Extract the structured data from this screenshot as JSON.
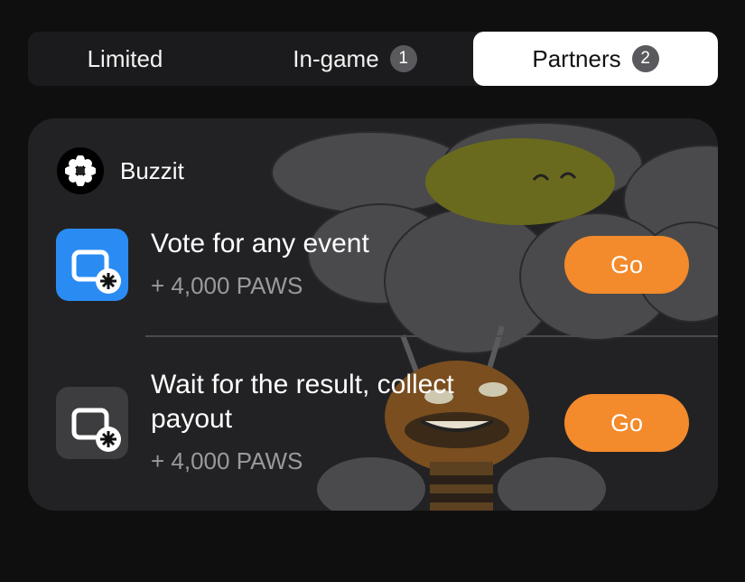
{
  "tabs": [
    {
      "label": "Limited",
      "badge": null,
      "active": false
    },
    {
      "label": "In-game",
      "badge": "1",
      "active": false
    },
    {
      "label": "Partners",
      "badge": "2",
      "active": true
    }
  ],
  "partner": {
    "name": "Buzzit",
    "tasks": [
      {
        "title": "Vote for any event",
        "reward": "+ 4,000 PAWS",
        "button": "Go",
        "icon_color": "#2a8cf3"
      },
      {
        "title": "Wait for the result, collect payout",
        "reward": "+ 4,000 PAWS",
        "button": "Go",
        "icon_color": "#3d3d3f"
      }
    ]
  },
  "colors": {
    "accent": "#f38a2b",
    "background": "#0f0f10",
    "card": "#222224"
  }
}
